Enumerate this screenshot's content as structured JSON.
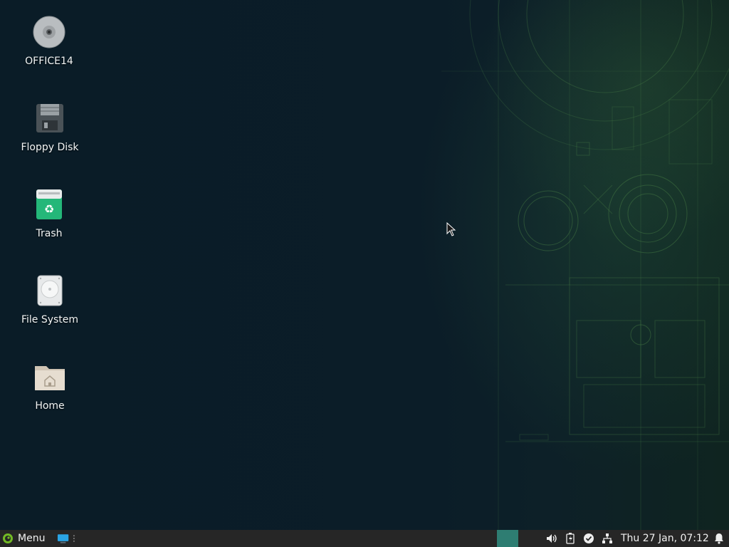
{
  "desktop": {
    "icons": [
      {
        "label": "OFFICE14",
        "icon": "optical-disc-icon"
      },
      {
        "label": "Floppy Disk",
        "icon": "floppy-disk-icon"
      },
      {
        "label": "Trash",
        "icon": "trash-icon"
      },
      {
        "label": "File System",
        "icon": "hard-drive-icon"
      },
      {
        "label": "Home",
        "icon": "home-folder-icon"
      }
    ]
  },
  "taskbar": {
    "menu_label": "Menu",
    "clock": "Thu 27 Jan, 07:12",
    "tray_icons": [
      "volume-icon",
      "battery-icon",
      "updates-check-icon",
      "network-icon"
    ],
    "accent_color": "#2e7d72",
    "background_color": "#262626"
  }
}
